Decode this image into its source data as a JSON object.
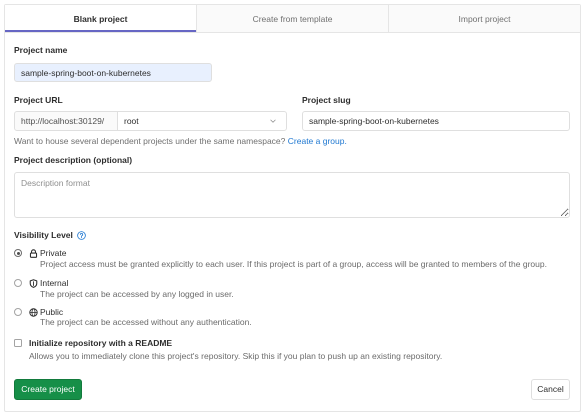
{
  "tabs": [
    {
      "label": "Blank project",
      "active": true
    },
    {
      "label": "Create from template",
      "active": false
    },
    {
      "label": "Import project",
      "active": false
    }
  ],
  "project_name": {
    "label": "Project name",
    "value": "sample-spring-boot-on-kubernetes"
  },
  "project_url": {
    "label": "Project URL",
    "prefix": "http://localhost:30129/",
    "namespace": "root",
    "namespace_icon": "chevron-down-icon"
  },
  "project_slug": {
    "label": "Project slug",
    "value": "sample-spring-boot-on-kubernetes"
  },
  "namespace_help": {
    "text": "Want to house several dependent projects under the same namespace?",
    "link": "Create a group."
  },
  "description": {
    "label": "Project description (optional)",
    "placeholder": "Description format"
  },
  "visibility": {
    "label": "Visibility Level",
    "help_icon": "question-circle-icon",
    "options": [
      {
        "label": "Private",
        "icon": "lock-icon",
        "selected": true,
        "description": "Project access must be granted explicitly to each user. If this project is part of a group, access will be granted to members of the group."
      },
      {
        "label": "Internal",
        "icon": "shield-icon",
        "selected": false,
        "description": "The project can be accessed by any logged in user."
      },
      {
        "label": "Public",
        "icon": "globe-icon",
        "selected": false,
        "description": "The project can be accessed without any authentication."
      }
    ]
  },
  "readme": {
    "label": "Initialize repository with a README",
    "description": "Allows you to immediately clone this project's repository. Skip this if you plan to push up an existing repository.",
    "checked": false
  },
  "actions": {
    "create_label": "Create project",
    "cancel_label": "Cancel"
  },
  "colors": {
    "link": "#1f78d1",
    "success": "#168f48",
    "tab_active": "#6666c4",
    "autofill": "#e8f0fe"
  }
}
